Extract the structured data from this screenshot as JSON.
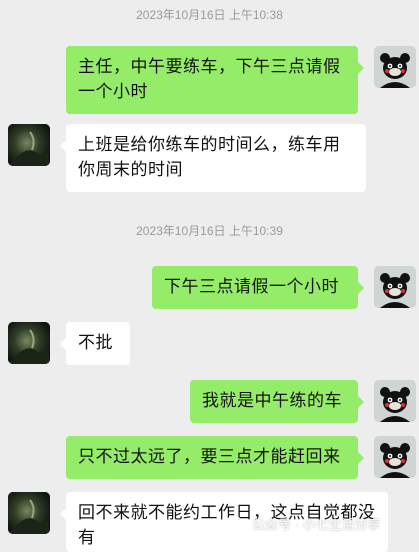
{
  "chat": {
    "timestamps": [
      "2023年10月16日 上午10:38",
      "2023年10月16日 上午10:39"
    ],
    "messages": [
      {
        "sender": "self",
        "text": "主任，中午要练车，下午三点请假一个小时"
      },
      {
        "sender": "other",
        "text": "上班是给你练车的时间么，练车用你周末的时间"
      },
      {
        "sender": "self",
        "text": "下午三点请假一个小时"
      },
      {
        "sender": "other",
        "text": "不批"
      },
      {
        "sender": "self",
        "text": "我就是中午练的车"
      },
      {
        "sender": "self",
        "text": "只不过太远了，要三点才能赶回来"
      },
      {
        "sender": "other",
        "text": "回不来就不能约工作日，这点自觉都没有"
      }
    ]
  },
  "watermark": {
    "text": "公众号 · 小七生活分享",
    "icon": "wechat-icon"
  },
  "colors": {
    "background": "#ededed",
    "self_bubble": "#95ec69",
    "other_bubble": "#ffffff",
    "timestamp": "#9a9a9a"
  }
}
